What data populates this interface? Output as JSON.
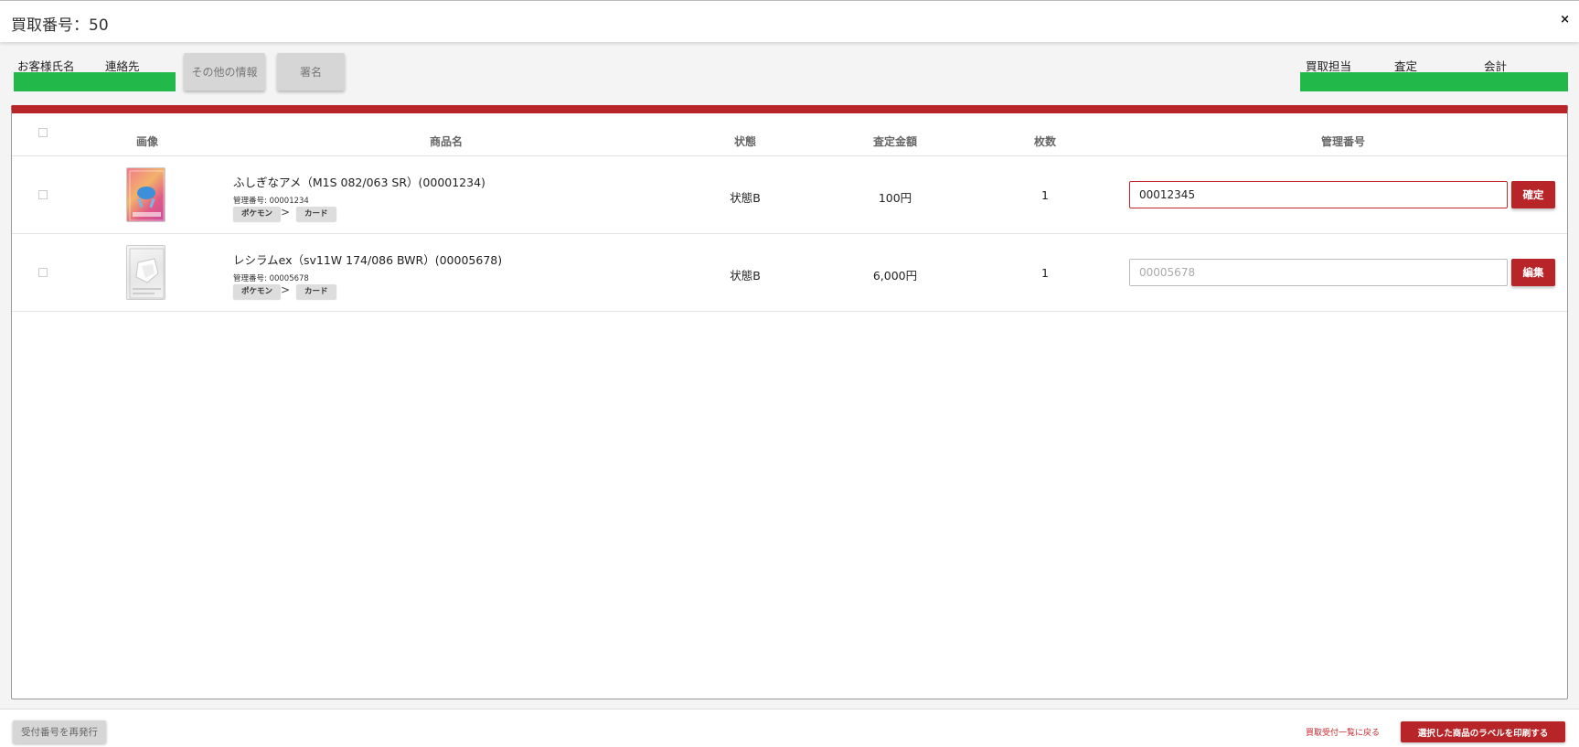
{
  "header": {
    "title": "買取番号：50",
    "close_label": "×"
  },
  "info": {
    "customer_name_label": "お客様氏名",
    "contact_label": "連絡先",
    "other_info_button": "その他の情報",
    "signature_button": "署名",
    "buyer_label": "買取担当",
    "assessment_label": "査定",
    "accounting_label": "会計",
    "status_color": "#22b84a"
  },
  "table": {
    "headers": {
      "image": "画像",
      "product_name": "商品名",
      "condition": "状態",
      "price": "査定金額",
      "quantity": "枚数",
      "management_number": "管理番号"
    },
    "rows": [
      {
        "name": "ふしぎなアメ（M1S 082/063 SR）(00001234)",
        "mgmt": "管理番号: 00001234",
        "category": "ポケモン",
        "subcategory": "カード",
        "separator": ">",
        "condition": "状態B",
        "price": "100円",
        "quantity": "1",
        "input_value": "00012345",
        "input_placeholder": "",
        "action": "確定"
      },
      {
        "name": "レシラムex（sv11W 174/086 BWR）(00005678)",
        "mgmt": "管理番号: 00005678",
        "category": "ポケモン",
        "subcategory": "カード",
        "separator": ">",
        "condition": "状態B",
        "price": "6,000円",
        "quantity": "1",
        "input_value": "",
        "input_placeholder": "00005678",
        "action": "編集"
      }
    ]
  },
  "footer": {
    "reissue_button": "受付番号を再発行",
    "back_link": "買取受付一覧に戻る",
    "print_button": "選択した商品のラベルを印刷する"
  },
  "colors": {
    "accent": "#b72529",
    "green": "#22b84a"
  }
}
